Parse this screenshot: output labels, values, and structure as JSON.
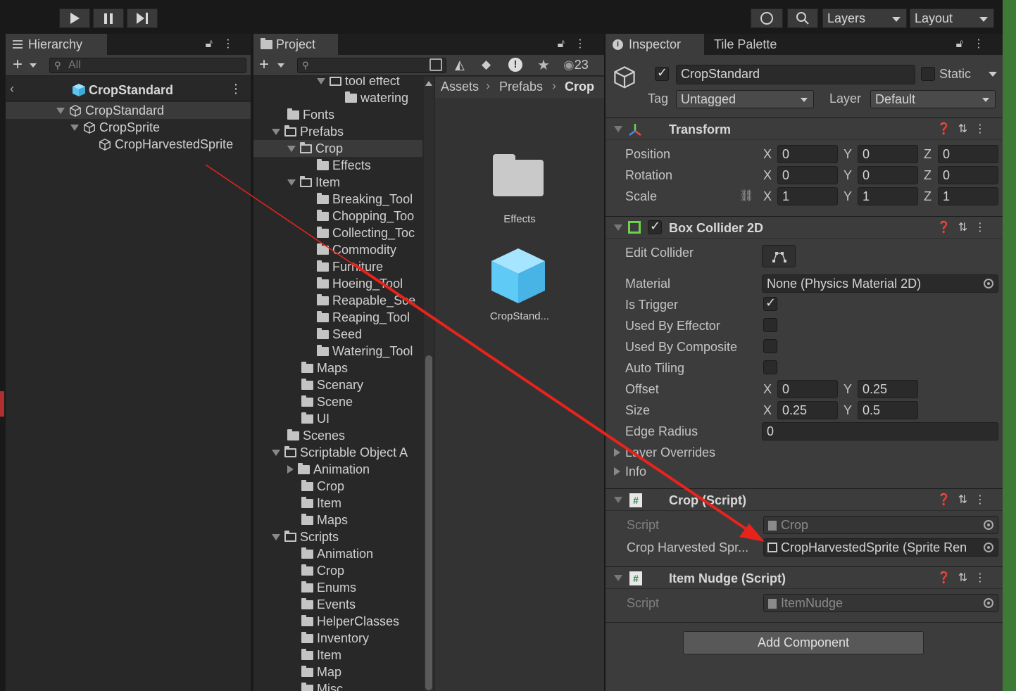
{
  "toolbar": {
    "layers_label": "Layers",
    "layout_label": "Layout"
  },
  "hierarchy": {
    "tab_label": "Hierarchy",
    "search_placeholder": "All",
    "scene_title": "CropStandard",
    "items": [
      {
        "label": "CropStandard"
      },
      {
        "label": "CropSprite"
      },
      {
        "label": "CropHarvestedSprite"
      }
    ]
  },
  "project": {
    "tab_label": "Project",
    "hidden_count": "23",
    "tree": [
      {
        "label": "tool effect"
      },
      {
        "label": "watering"
      },
      {
        "label": "Fonts"
      },
      {
        "label": "Prefabs"
      },
      {
        "label": "Crop"
      },
      {
        "label": "Effects"
      },
      {
        "label": "Item"
      },
      {
        "label": "Breaking_Tool"
      },
      {
        "label": "Chopping_Too"
      },
      {
        "label": "Collecting_Toc"
      },
      {
        "label": "Commodity"
      },
      {
        "label": "Furniture"
      },
      {
        "label": "Hoeing_Tool"
      },
      {
        "label": "Reapable_Sce"
      },
      {
        "label": "Reaping_Tool"
      },
      {
        "label": "Seed"
      },
      {
        "label": "Watering_Tool"
      },
      {
        "label": "Maps"
      },
      {
        "label": "Scenary"
      },
      {
        "label": "Scene"
      },
      {
        "label": "UI"
      },
      {
        "label": "Scenes"
      },
      {
        "label": "Scriptable Object A"
      },
      {
        "label": "Animation"
      },
      {
        "label": "Crop"
      },
      {
        "label": "Item"
      },
      {
        "label": "Maps"
      },
      {
        "label": "Scripts"
      },
      {
        "label": "Animation"
      },
      {
        "label": "Crop"
      },
      {
        "label": "Enums"
      },
      {
        "label": "Events"
      },
      {
        "label": "HelperClasses"
      },
      {
        "label": "Inventory"
      },
      {
        "label": "Item"
      },
      {
        "label": "Map"
      },
      {
        "label": "Misc"
      }
    ],
    "breadcrumb": [
      "Assets",
      "Prefabs",
      "Crop"
    ],
    "assets": [
      {
        "label": "Effects"
      },
      {
        "label": "CropStand..."
      }
    ]
  },
  "inspector": {
    "tab_label": "Inspector",
    "tab2_label": "Tile Palette",
    "object_name": "CropStandard",
    "static_label": "Static",
    "tag_label": "Tag",
    "tag_value": "Untagged",
    "layer_label": "Layer",
    "layer_value": "Default",
    "transform": {
      "title": "Transform",
      "position_label": "Position",
      "rotation_label": "Rotation",
      "scale_label": "Scale",
      "position": {
        "x": "0",
        "y": "0",
        "z": "0"
      },
      "rotation": {
        "x": "0",
        "y": "0",
        "z": "0"
      },
      "scale": {
        "x": "1",
        "y": "1",
        "z": "1"
      }
    },
    "box_collider": {
      "title": "Box Collider 2D",
      "edit_collider_label": "Edit Collider",
      "material_label": "Material",
      "material_value": "None (Physics Material 2D)",
      "is_trigger_label": "Is Trigger",
      "is_trigger": true,
      "used_by_effector_label": "Used By Effector",
      "used_by_composite_label": "Used By Composite",
      "auto_tiling_label": "Auto Tiling",
      "offset_label": "Offset",
      "offset": {
        "x": "0",
        "y": "0.25"
      },
      "size_label": "Size",
      "size": {
        "x": "0.25",
        "y": "0.5"
      },
      "edge_radius_label": "Edge Radius",
      "edge_radius": "0",
      "layer_overrides_label": "Layer Overrides",
      "info_label": "Info"
    },
    "crop_script": {
      "title": "Crop (Script)",
      "script_label": "Script",
      "script_value": "Crop",
      "harvested_label": "Crop Harvested Spr...",
      "harvested_value": "CropHarvestedSprite (Sprite Ren"
    },
    "item_nudge": {
      "title": "Item Nudge (Script)",
      "script_label": "Script",
      "script_value": "ItemNudge"
    },
    "add_component_label": "Add Component"
  },
  "axis_labels": {
    "x": "X",
    "y": "Y",
    "z": "Z"
  },
  "colors": {
    "annotation_arrow": "#e8231c",
    "prefab_blue": "#6ccff6",
    "collider_green": "#6dd34a"
  }
}
